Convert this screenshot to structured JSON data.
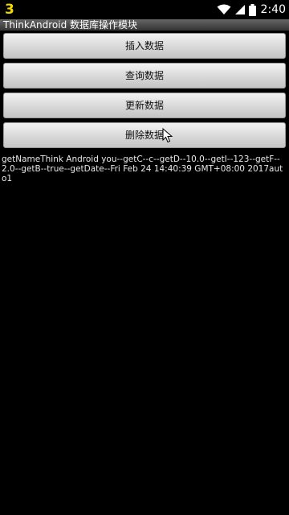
{
  "status_bar": {
    "notification_icon_text": "3",
    "time": "2:40",
    "icons": [
      "wifi-icon",
      "signal-icon",
      "battery-icon"
    ],
    "accent_color": "#f2d600"
  },
  "app": {
    "title": "ThinkAndroid 数据库操作模块"
  },
  "buttons": {
    "insert": "插入数据",
    "query": "查询数据",
    "update": "更新数据",
    "delete": "删除数据"
  },
  "output": {
    "text": "getNameThink Android you--getC--c--getD--10.0--getI--123--getF--2.0--getB--true--getDate--Fri Feb 24 14:40:39 GMT+08:00 2017auto1"
  }
}
